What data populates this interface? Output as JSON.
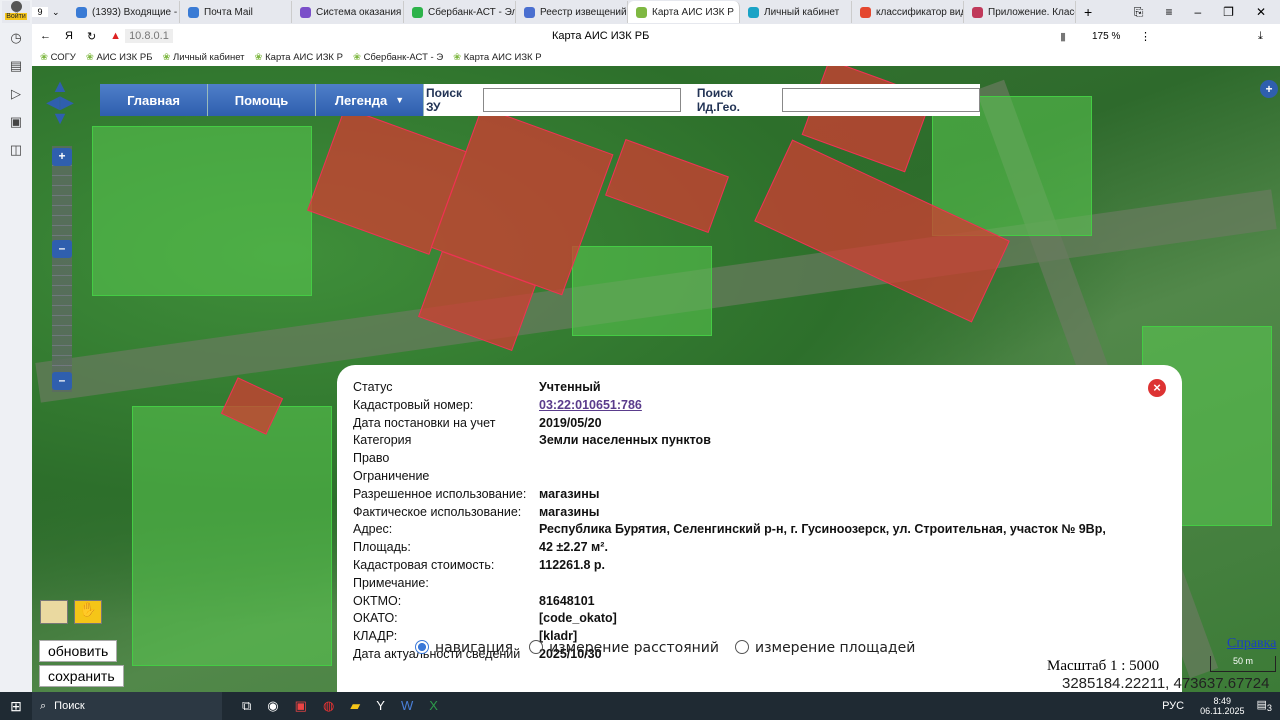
{
  "browser": {
    "tab_count": "9",
    "tabs": [
      {
        "label": "(1393) Входящие - П",
        "color": "#3a7bd5"
      },
      {
        "label": "Почта Mail",
        "color": "#3a7bd5"
      },
      {
        "label": "Система оказания г",
        "color": "#7a4fc9"
      },
      {
        "label": "Сбербанк-АСТ - Эл",
        "color": "#2db34a"
      },
      {
        "label": "Реестр извещений",
        "color": "#4a6fd0"
      },
      {
        "label": "Карта АИС ИЗК Р",
        "color": "#7fb842",
        "active": true
      },
      {
        "label": "Личный кабинет",
        "color": "#1aa3c6"
      },
      {
        "label": "классификатор вид",
        "color": "#e4472f"
      },
      {
        "label": "Приложение. Класс",
        "color": "#c0395a"
      }
    ],
    "login_label": "Войти",
    "url": "10.8.0.1",
    "page_title": "Карта АИС ИЗК РБ",
    "zoom": "175 %",
    "bookmarks": [
      "СОГУ",
      "АИС ИЗК РБ",
      "Личный кабинет",
      "Карта АИС ИЗК Р",
      "Сбербанк-АСТ - Э",
      "Карта АИС ИЗК Р"
    ]
  },
  "menu": {
    "items": [
      "Главная",
      "Помощь",
      "Легенда"
    ],
    "search_zu_label": "Поиск ЗУ",
    "search_zu_value": "",
    "search_geo_label": "Поиск Ид.Гео.",
    "search_geo_value": ""
  },
  "popup": {
    "rows": [
      {
        "label": "Статус",
        "value": "Учтенный"
      },
      {
        "label": "Кадастровый номер:",
        "value": "03:22:010651:786",
        "link": true
      },
      {
        "label": "Дата постановки на учет",
        "value": "2019/05/20"
      },
      {
        "label": "Категория",
        "value": "Земли населенных пунктов"
      },
      {
        "label": "Право",
        "value": ""
      },
      {
        "label": "Ограничение",
        "value": ""
      },
      {
        "label": "Разрешенное использование:",
        "value": "магазины"
      },
      {
        "label": "Фактическое использование:",
        "value": "магазины"
      },
      {
        "label": "Адрес:",
        "value": "Республика Бурятия, Селенгинский р-н, г. Гусиноозерск, ул. Строительная, участок № 9Вр,"
      },
      {
        "label": "Площадь:",
        "value": "42 ±2.27 м²."
      },
      {
        "label": "Кадастровая стоимость:",
        "value": "112261.8 р."
      },
      {
        "label": "Примечание:",
        "value": ""
      },
      {
        "label": "ОКТМО:",
        "value": "81648101"
      },
      {
        "label": "ОКАТО:",
        "value": "[code_okato]"
      },
      {
        "label": "КЛАДР:",
        "value": "[kladr]"
      },
      {
        "label": "Дата актуальности сведений",
        "value": "2025/10/30"
      }
    ]
  },
  "modes": {
    "options": [
      "навигация",
      "измерение расстояний",
      "измерение площадей"
    ],
    "selected": 0
  },
  "buttons": {
    "refresh": "обновить",
    "save": "сохранить"
  },
  "scale": {
    "label": "Масштаб 1 : 5000",
    "bar": "50 m",
    "help_link": "Справка",
    "coords": "3285184.22211, 473637.67724"
  },
  "taskbar": {
    "search": "Поиск",
    "lang": "РУС",
    "time": "8:49",
    "date": "06.11.2025",
    "notifications": "3"
  }
}
